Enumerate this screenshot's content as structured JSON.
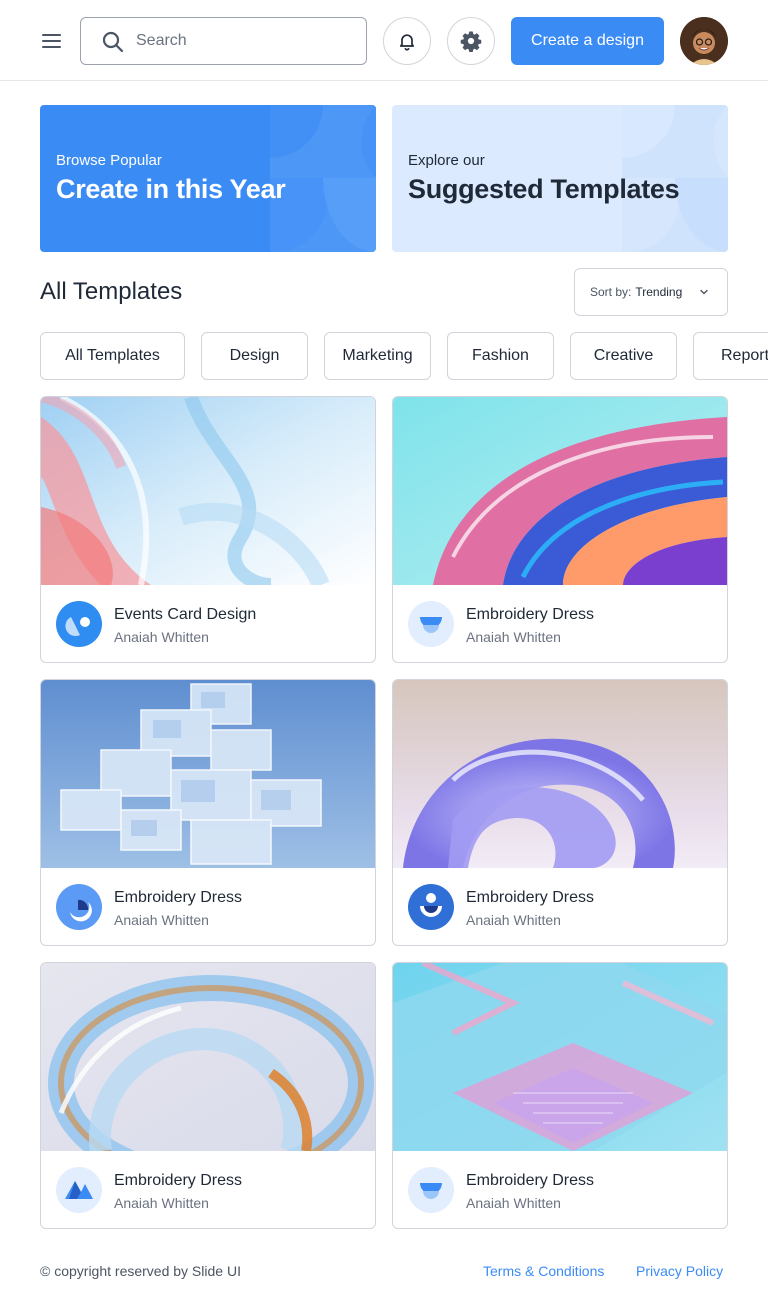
{
  "header": {
    "search_placeholder": "Search",
    "create_label": "Create a design"
  },
  "banners": [
    {
      "small": "Browse Popular",
      "big": "Create in this Year"
    },
    {
      "small": "Explore our",
      "big": "Suggested Templates"
    }
  ],
  "section": {
    "title": "All Templates",
    "sort_label": "Sort by:",
    "sort_value": "Trending"
  },
  "chips": [
    "All Templates",
    "Design",
    "Marketing",
    "Fashion",
    "Creative",
    "Report"
  ],
  "cards": [
    {
      "title": "Events Card Design",
      "author": "Anaiah Whitten"
    },
    {
      "title": "Embroidery Dress",
      "author": "Anaiah Whitten"
    },
    {
      "title": "Embroidery Dress",
      "author": "Anaiah Whitten"
    },
    {
      "title": "Embroidery Dress",
      "author": "Anaiah Whitten"
    },
    {
      "title": "Embroidery Dress",
      "author": "Anaiah Whitten"
    },
    {
      "title": "Embroidery Dress",
      "author": "Anaiah Whitten"
    }
  ],
  "footer": {
    "copyright": "© copyright reserved by Slide UI",
    "terms": "Terms & Conditions",
    "privacy": "Privacy Policy"
  },
  "colors": {
    "primary": "#3b8bf5",
    "primary_light": "#dbeafe",
    "border": "#d1d5db"
  }
}
